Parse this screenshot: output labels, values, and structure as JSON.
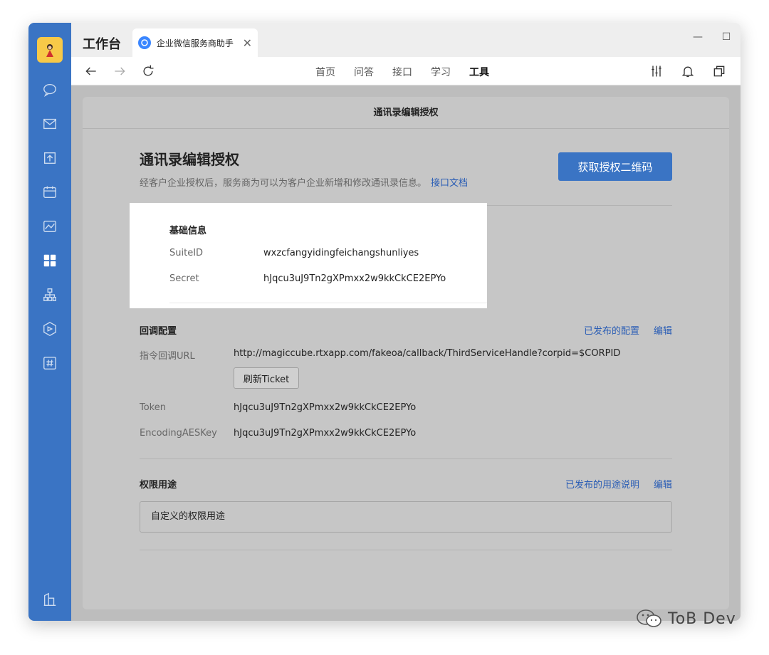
{
  "app": {
    "title": "工作台"
  },
  "tab": {
    "label": "企业微信服务商助手"
  },
  "nav": {
    "items": [
      "首页",
      "问答",
      "接口",
      "学习",
      "工具"
    ],
    "active": "工具"
  },
  "page": {
    "header": "通讯录编辑授权",
    "title": "通讯录编辑授权",
    "description": "经客户企业授权后，服务商为可以为客户企业新增和修改通讯录信息。",
    "doc_link": "接口文档",
    "qr_button": "获取授权二维码"
  },
  "basic_info": {
    "title": "基础信息",
    "suite_id_label": "SuiteID",
    "suite_id": "wxzcfangyidingfeichangshunliyes",
    "secret_label": "Secret",
    "secret": "hJqcu3uJ9Tn2gXPmxx2w9kkCkCE2EPYo"
  },
  "callback": {
    "title": "回调配置",
    "published_link": "已发布的配置",
    "edit_link": "编辑",
    "url_label": "指令回调URL",
    "url": "http://magiccube.rtxapp.com/fakeoa/callback/ThirdServiceHandle?corpid=$CORPID",
    "refresh_button": "刷新Ticket",
    "token_label": "Token",
    "token": "hJqcu3uJ9Tn2gXPmxx2w9kkCkCE2EPYo",
    "aes_label": "EncodingAESKey",
    "aes": "hJqcu3uJ9Tn2gXPmxx2w9kkCkCE2EPYo"
  },
  "permission": {
    "title": "权限用途",
    "published_link": "已发布的用途说明",
    "edit_link": "编辑",
    "value": "自定义的权限用途"
  },
  "watermark": {
    "text": "ToB Dev"
  },
  "colors": {
    "sidebar": "#3a74c4",
    "primary": "#3a74c4",
    "link": "#2a5db5"
  }
}
